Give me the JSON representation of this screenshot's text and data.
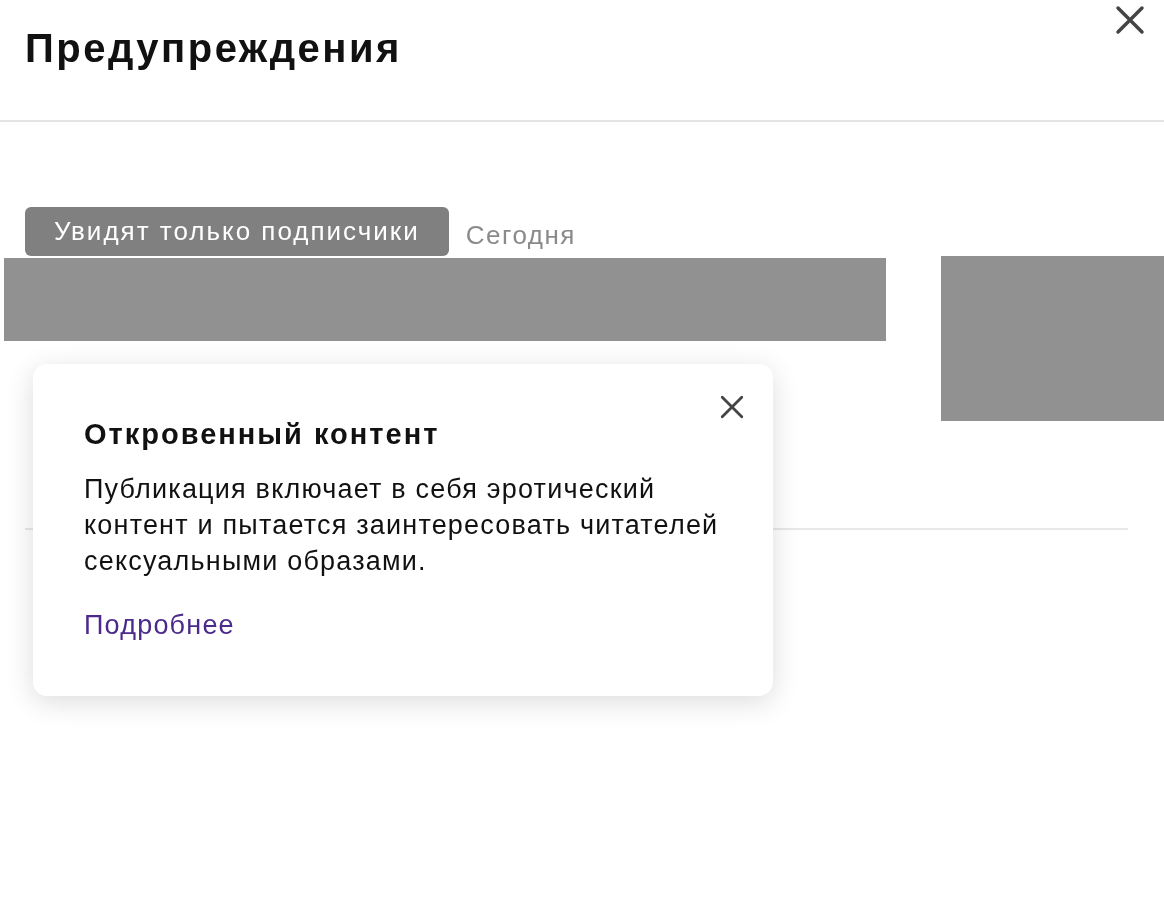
{
  "header": {
    "title": "Предупреждения"
  },
  "post": {
    "badge": "Увидят только подписчики",
    "date": "Сегодня"
  },
  "popup": {
    "title": "Откровенный контент",
    "text": "Публикация включает в себя эротический контент и пытается заинтересовать читателей сексуальными образами.",
    "link": "Подробнее"
  }
}
